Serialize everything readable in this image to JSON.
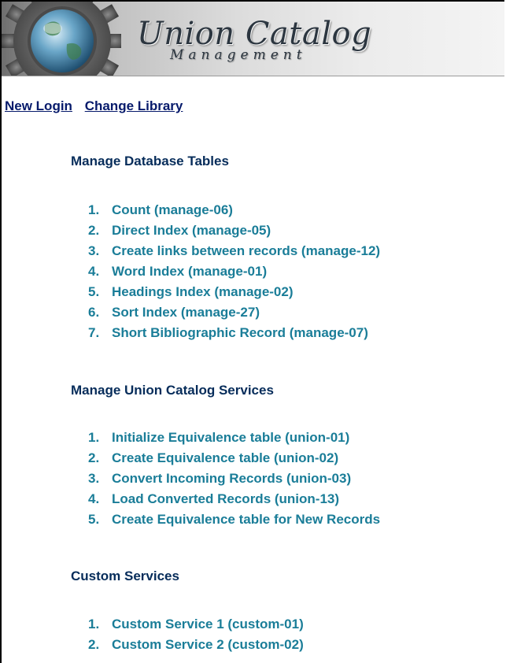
{
  "header": {
    "title": "Union Catalog",
    "subtitle": "Management",
    "logo_icon": "globe-gear-icon"
  },
  "nav": {
    "new_login": "New Login",
    "change_library": "Change Library"
  },
  "sections": [
    {
      "heading": "Manage Database Tables",
      "items": [
        {
          "num": "1.",
          "label": "Count (manage-06)"
        },
        {
          "num": "2.",
          "label": "Direct Index (manage-05)"
        },
        {
          "num": "3.",
          "label": "Create links between records (manage-12)"
        },
        {
          "num": "4.",
          "label": "Word Index (manage-01)"
        },
        {
          "num": "5.",
          "label": "Headings Index (manage-02)"
        },
        {
          "num": "6.",
          "label": "Sort Index (manage-27)"
        },
        {
          "num": "7.",
          "label": "Short Bibliographic Record (manage-07)"
        }
      ]
    },
    {
      "heading": "Manage Union Catalog Services",
      "items": [
        {
          "num": "1.",
          "label": "Initialize Equivalence table (union-01)"
        },
        {
          "num": "2.",
          "label": "Create Equivalence table (union-02)"
        },
        {
          "num": "3.",
          "label": "Convert Incoming Records (union-03)"
        },
        {
          "num": "4.",
          "label": "Load Converted Records (union-13)"
        },
        {
          "num": "5.",
          "label": "Create Equivalence table for New Records"
        }
      ]
    },
    {
      "heading": "Custom Services",
      "items": [
        {
          "num": "1.",
          "label": "Custom Service 1 (custom-01)"
        },
        {
          "num": "2.",
          "label": "Custom Service 2 (custom-02)"
        }
      ]
    }
  ],
  "colors": {
    "nav_link": "#061a6b",
    "heading": "#062c5a",
    "item_link": "#1a7d98"
  }
}
